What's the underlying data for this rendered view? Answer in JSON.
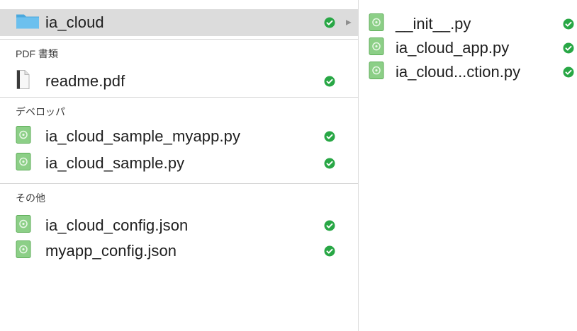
{
  "colors": {
    "selection": "#dcdcdc",
    "sync_ok": "#28a745",
    "folder": "#5fb6e6",
    "python_icon": "#7cc47a"
  },
  "left_column": {
    "selected": {
      "name": "ia_cloud",
      "icon": "folder-icon",
      "status": "synced-check-icon",
      "disclosure": "disclosure-triangle-icon"
    },
    "groups": [
      {
        "header": "PDF 書類",
        "items": [
          {
            "name": "readme.pdf",
            "icon": "pdf-document-icon",
            "status": "synced-check-icon"
          }
        ]
      },
      {
        "header": "デベロッパ",
        "items": [
          {
            "name": "ia_cloud_sample_myapp.py",
            "icon": "python-file-icon",
            "status": "synced-check-icon"
          },
          {
            "name": "ia_cloud_sample.py",
            "icon": "python-file-icon",
            "status": "synced-check-icon"
          }
        ]
      },
      {
        "header": "その他",
        "items": [
          {
            "name": "ia_cloud_config.json",
            "icon": "python-file-icon",
            "status": "synced-check-icon"
          },
          {
            "name": "myapp_config.json",
            "icon": "python-file-icon",
            "status": "synced-check-icon"
          }
        ]
      }
    ]
  },
  "right_column": {
    "items": [
      {
        "name": "__init__.py",
        "icon": "python-file-icon",
        "status": "synced-check-icon"
      },
      {
        "name": "ia_cloud_app.py",
        "icon": "python-file-icon",
        "status": "synced-check-icon"
      },
      {
        "name": "ia_cloud...ction.py",
        "icon": "python-file-icon",
        "status": "synced-check-icon"
      }
    ]
  }
}
